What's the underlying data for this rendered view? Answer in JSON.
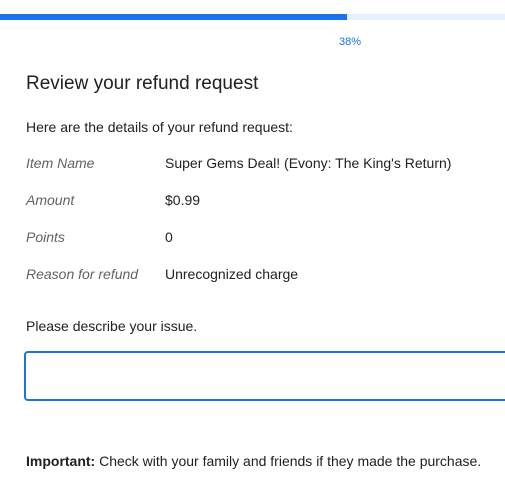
{
  "progress": {
    "percent": 38,
    "label": "38%"
  },
  "form": {
    "title": "Review your refund request",
    "intro": "Here are the details of your refund request:",
    "details": [
      {
        "label": "Item Name",
        "value": "Super Gems Deal! (Evony: The King's Return)"
      },
      {
        "label": "Amount",
        "value": "$0.99"
      },
      {
        "label": "Points",
        "value": "0"
      },
      {
        "label": "Reason for refund",
        "value": "Unrecognized charge"
      }
    ],
    "describe_label": "Please describe your issue.",
    "issue_value": "",
    "important_prefix": "Important:",
    "important_text": " Check with your family and friends if they made the purchase."
  },
  "colors": {
    "accent": "#1a73e8",
    "track": "#e8f0fe"
  }
}
